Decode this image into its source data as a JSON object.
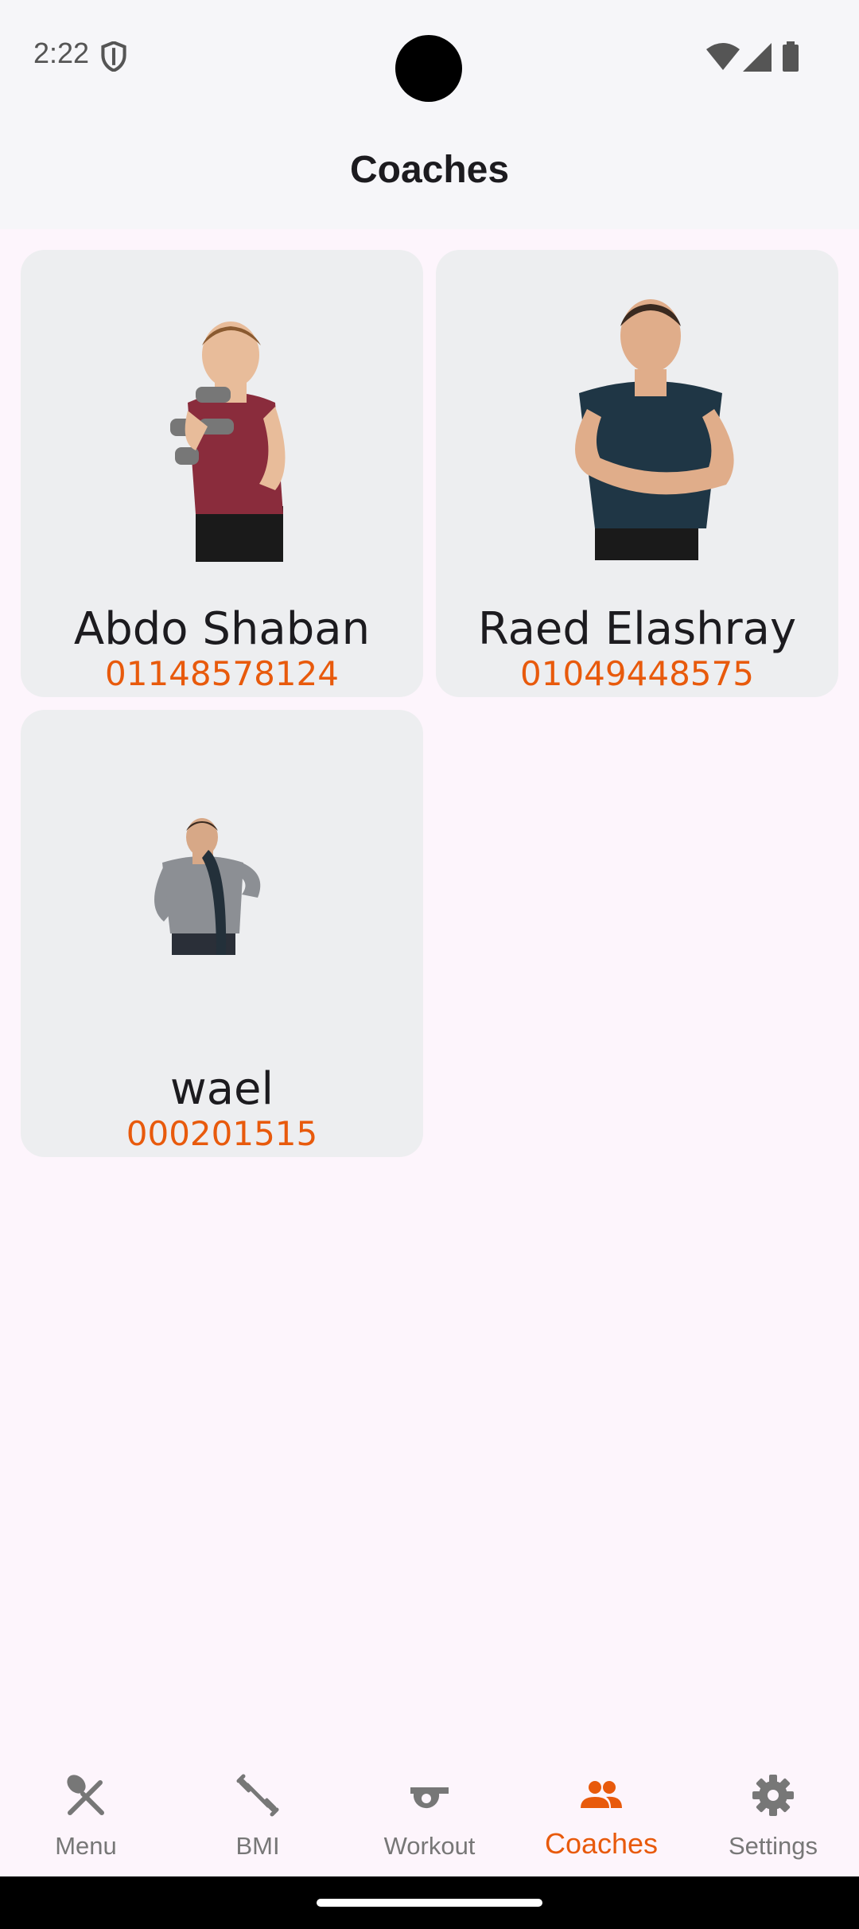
{
  "status_bar": {
    "time": "2:22"
  },
  "app_bar": {
    "title": "Coaches"
  },
  "coaches": [
    {
      "name": "Abdo Shaban",
      "phone": "01148578124"
    },
    {
      "name": "Raed Elashray",
      "phone": "01049448575"
    },
    {
      "name": "wael",
      "phone": "000201515"
    }
  ],
  "bottom_nav": {
    "items": [
      {
        "label": "Menu",
        "icon": "fork-knife-icon"
      },
      {
        "label": "BMI",
        "icon": "dumbbell-icon"
      },
      {
        "label": "Workout",
        "icon": "whistle-icon"
      },
      {
        "label": "Coaches",
        "icon": "people-icon",
        "active": true
      },
      {
        "label": "Settings",
        "icon": "gear-icon"
      }
    ]
  },
  "colors": {
    "accent": "#e85a0c",
    "card_bg": "#edeef0",
    "page_bg": "#fdf5fc"
  }
}
